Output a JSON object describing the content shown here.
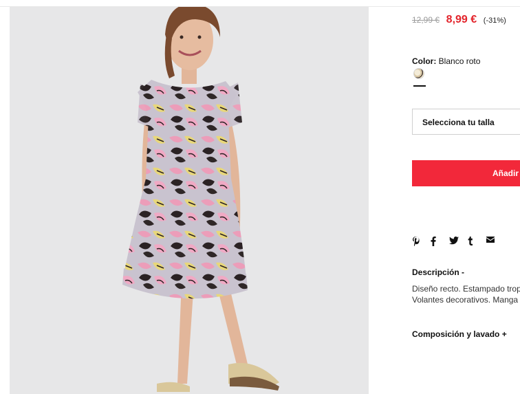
{
  "product": {
    "image_alt": "Girl wearing a tropical leaf print dress",
    "old_price": "12,99 €",
    "price": "8,99 €",
    "discount": "(-31%)"
  },
  "color": {
    "label": "Color:",
    "value": "Blanco roto"
  },
  "size": {
    "placeholder": "Selecciona tu talla"
  },
  "cart": {
    "add_label": "Añadir"
  },
  "share": {
    "icons": [
      "pinterest-icon",
      "facebook-icon",
      "twitter-icon",
      "tumblr-icon",
      "mail-icon"
    ]
  },
  "description": {
    "title": "Descripción -",
    "line1": "Diseño recto. Estampado trop",
    "line2": "Volantes decorativos. Manga c"
  },
  "composition": {
    "title": "Composición y lavado +"
  }
}
